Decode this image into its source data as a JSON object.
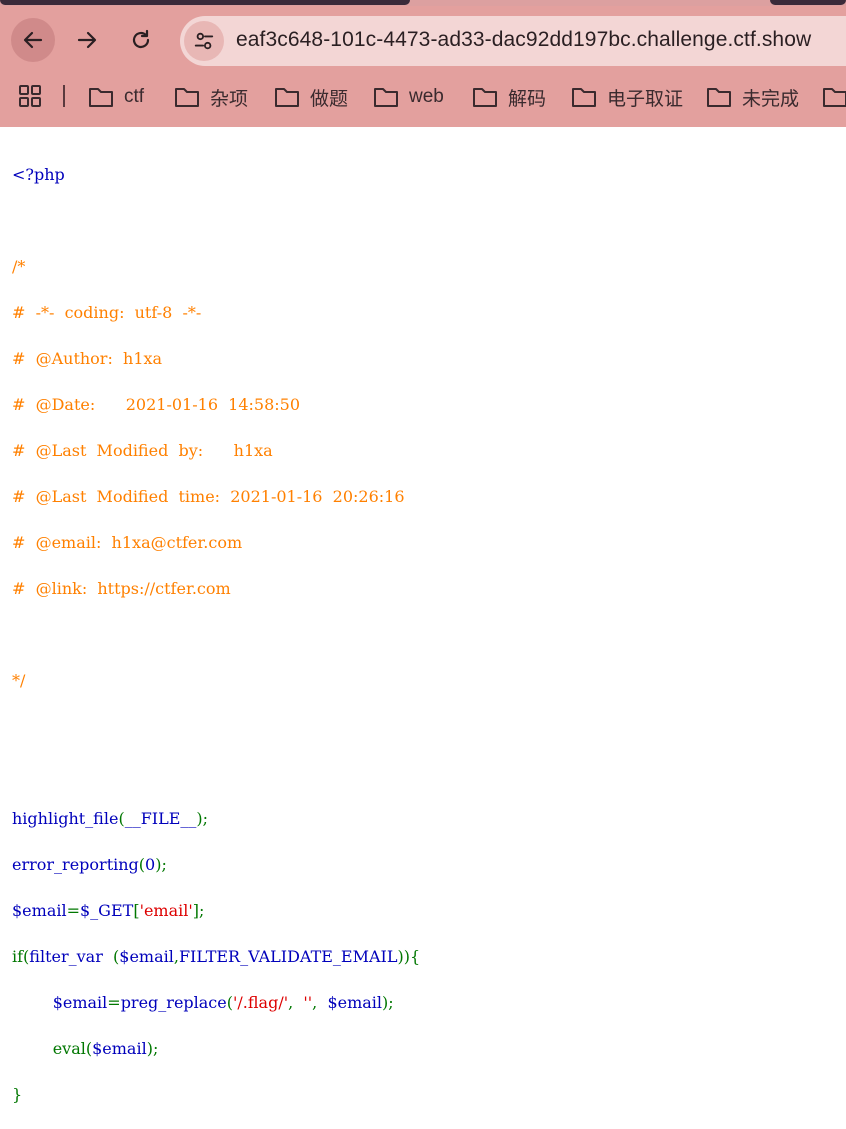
{
  "browser": {
    "url": "eaf3c648-101c-4473-ad33-dac92dd197bc.challenge.ctf.show",
    "bookmarks": [
      "ctf",
      "杂项",
      "做题",
      "web",
      "解码",
      "电子取证",
      "未完成",
      ""
    ]
  },
  "code": {
    "open_tag": "<?php",
    "comment": [
      "/*",
      "#  -*-  coding:  utf-8  -*-",
      "#  @Author:  h1xa",
      "#  @Date:      2021-01-16  14:58:50",
      "#  @Last  Modified  by:      h1xa",
      "#  @Last  Modified  time:  2021-01-16  20:26:16",
      "#  @email:  h1xa@ctfer.com",
      "#  @link:  https://ctfer.com",
      "",
      "*/"
    ],
    "l1a": "highlight_file",
    "l1b": "(",
    "l1c": "__FILE__",
    "l1d": ");",
    "l2a": "error_reporting",
    "l2b": "(",
    "l2c": "0",
    "l2d": ");",
    "l3a": "$email",
    "l3b": "=",
    "l3c": "$_GET",
    "l3d": "[",
    "l3e": "'email'",
    "l3f": "];",
    "l4a": "if(",
    "l4b": "filter_var  ",
    "l4c": "(",
    "l4d": "$email",
    "l4e": ",",
    "l4f": "FILTER_VALIDATE_EMAIL",
    "l4g": ")){",
    "l5a": "$email",
    "l5b": "=",
    "l5c": "preg_replace",
    "l5d": "(",
    "l5e": "'/.flag/'",
    "l5f": ",  ",
    "l5g": "''",
    "l5h": ",  ",
    "l5i": "$email",
    "l5j": ");",
    "l6a": "eval",
    "l6b": "(",
    "l6c": "$email",
    "l6d": ");",
    "l7": "}"
  }
}
